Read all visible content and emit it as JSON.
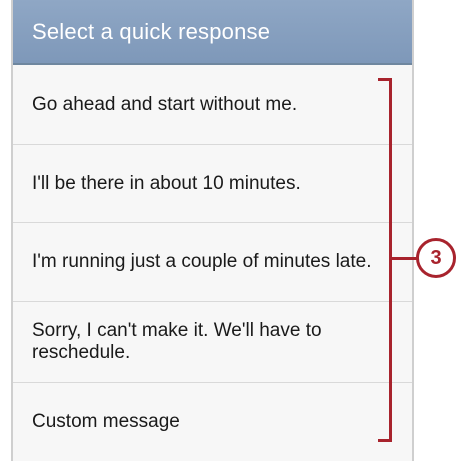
{
  "dialog": {
    "title": "Select a quick response",
    "responses": [
      "Go ahead and start without me.",
      "I'll be there in about 10 minutes.",
      "I'm running just a couple of minutes late.",
      "Sorry, I can't make it. We'll have to reschedule.",
      "Custom message"
    ]
  },
  "callout": {
    "number": "3",
    "color": "#a8232d"
  }
}
